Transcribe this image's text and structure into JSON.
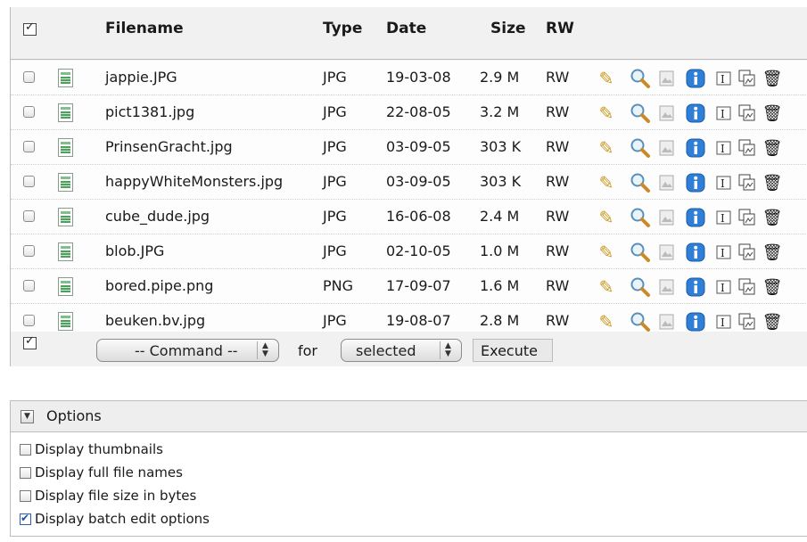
{
  "table": {
    "headers": {
      "filename": "Filename",
      "type": "Type",
      "date": "Date",
      "size": "Size",
      "rw": "RW"
    },
    "rows": [
      {
        "filename": "jappie.JPG",
        "type": "JPG",
        "date": "19-03-08",
        "size": "2.9 M",
        "rw": "RW"
      },
      {
        "filename": "pict1381.jpg",
        "type": "JPG",
        "date": "22-08-05",
        "size": "3.2 M",
        "rw": "RW"
      },
      {
        "filename": "PrinsenGracht.jpg",
        "type": "JPG",
        "date": "03-09-05",
        "size": "303 K",
        "rw": "RW"
      },
      {
        "filename": "happyWhiteMonsters.jpg",
        "type": "JPG",
        "date": "03-09-05",
        "size": "303 K",
        "rw": "RW"
      },
      {
        "filename": "cube_dude.jpg",
        "type": "JPG",
        "date": "16-06-08",
        "size": "2.4 M",
        "rw": "RW"
      },
      {
        "filename": "blob.JPG",
        "type": "JPG",
        "date": "02-10-05",
        "size": "1.0 M",
        "rw": "RW"
      },
      {
        "filename": "bored.pipe.png",
        "type": "PNG",
        "date": "17-09-07",
        "size": "1.6 M",
        "rw": "RW"
      },
      {
        "filename": "beuken.bv.jpg",
        "type": "JPG",
        "date": "19-08-07",
        "size": "2.8 M",
        "rw": "RW"
      }
    ],
    "row_icons": [
      "file-icon",
      "edit-pencil-icon",
      "view-magnifier-icon",
      "thumbnail-icon",
      "info-icon",
      "rename-icon",
      "copy-icon",
      "delete-trash-icon"
    ]
  },
  "batch": {
    "command_select": "-- Command --",
    "for_label": "for",
    "target_select": "selected",
    "execute_label": "Execute"
  },
  "options": {
    "title": "Options",
    "items": [
      {
        "label": "Display thumbnails",
        "checked": false
      },
      {
        "label": "Display full file names",
        "checked": false
      },
      {
        "label": "Display file size in bytes",
        "checked": false
      },
      {
        "label": "Display batch edit options",
        "checked": true
      }
    ]
  },
  "colors": {
    "info_blue": "#2f7fd6",
    "edit_yellow": "#c9981f",
    "check_blue": "#1c4fb0"
  }
}
